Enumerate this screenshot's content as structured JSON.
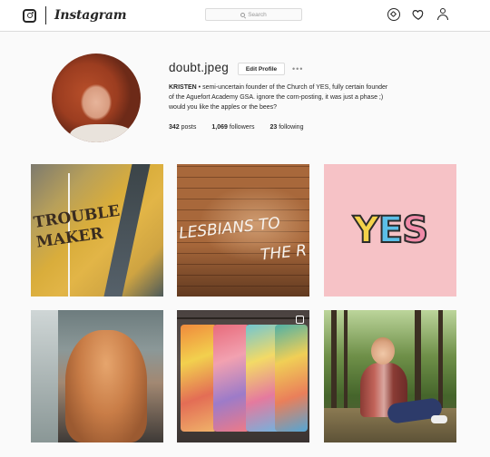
{
  "nav": {
    "logo_icon": "instagram-camera-icon",
    "wordmark": "Instagram",
    "search_placeholder": "Search",
    "icons": [
      "compass-icon",
      "heart-icon",
      "user-icon"
    ]
  },
  "profile": {
    "username": "doubt.jpeg",
    "edit_button": "Edit Profile",
    "more_options": "•••",
    "bio_name": "KRISTEN",
    "bio_line1": " • semi-uncertain founder of the Church of YES, fully certain founder",
    "bio_line2": "of the Aguefort Academy GSA. ignore the corn-posting, it was just a phase ;)",
    "bio_line3": "would you like the apples or the bees?",
    "stats": {
      "posts_count": "342",
      "posts_label": "posts",
      "followers_count": "1,069",
      "followers_label": "followers",
      "following_count": "23",
      "following_label": "following"
    }
  },
  "posts": [
    {
      "id": "post-1",
      "description_text": "TROUBLE MAKER"
    },
    {
      "id": "post-2",
      "description_text_1": "LESBIANS TO",
      "description_text_2": "THE R"
    },
    {
      "id": "post-3",
      "description_text": "YES"
    },
    {
      "id": "post-4"
    },
    {
      "id": "post-5",
      "badge_icon": "multiple-photos-icon"
    },
    {
      "id": "post-6"
    }
  ],
  "colors": {
    "background": "#fafafa",
    "border": "#dbdbdb",
    "text": "#262626",
    "muted": "#8e8e8e"
  }
}
